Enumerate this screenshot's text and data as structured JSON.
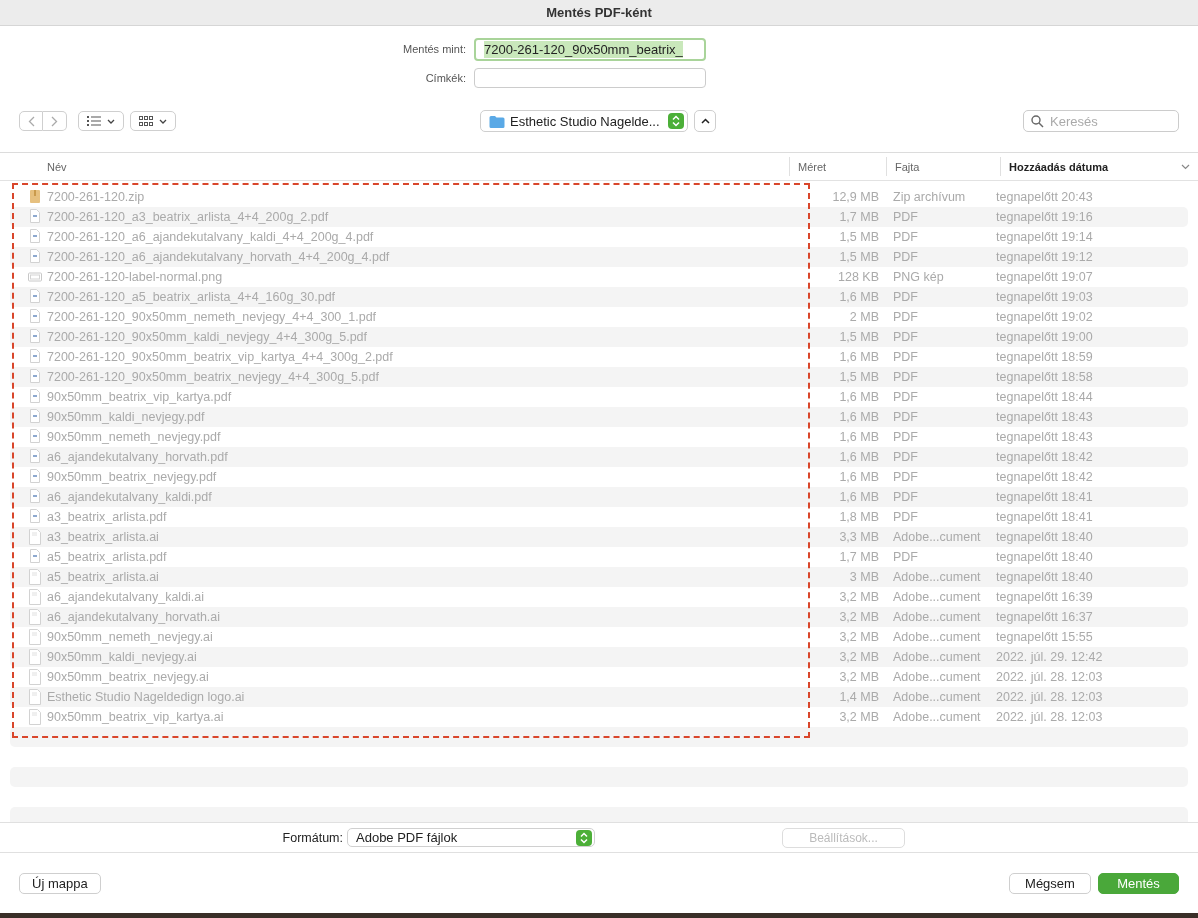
{
  "window": {
    "title": "Mentés PDF-ként"
  },
  "save_as": {
    "label": "Mentés mint:",
    "value": "7200-261-120_90x50mm_beatrix_",
    "selected": true
  },
  "tags": {
    "label": "Címkék:"
  },
  "location": {
    "label": "Esthetic Studio Nagelde..."
  },
  "search": {
    "placeholder": "Keresés"
  },
  "columns": [
    {
      "label": "Név",
      "sorted": false
    },
    {
      "label": "Méret",
      "sorted": false
    },
    {
      "label": "Fajta",
      "sorted": false
    },
    {
      "label": "Hozzáadás dátuma",
      "sorted": true
    }
  ],
  "rows": [
    {
      "kind": "zip",
      "name": "7200-261-120.zip",
      "size": "12,9 MB",
      "kind_label": "Zip archívum",
      "date": "tegnapelőtt 20:43"
    },
    {
      "kind": "pdf",
      "name": "7200-261-120_a3_beatrix_arlista_4+4_200g_2.pdf",
      "size": "1,7 MB",
      "kind_label": "PDF",
      "date": "tegnapelőtt 19:16"
    },
    {
      "kind": "pdf",
      "name": "7200-261-120_a6_ajandekutalvany_kaldi_4+4_200g_4.pdf",
      "size": "1,5 MB",
      "kind_label": "PDF",
      "date": "tegnapelőtt 19:14"
    },
    {
      "kind": "pdf",
      "name": "7200-261-120_a6_ajandekutalvany_horvath_4+4_200g_4.pdf",
      "size": "1,5 MB",
      "kind_label": "PDF",
      "date": "tegnapelőtt 19:12"
    },
    {
      "kind": "png",
      "name": "7200-261-120-label-normal.png",
      "size": "128 KB",
      "kind_label": "PNG kép",
      "date": "tegnapelőtt 19:07"
    },
    {
      "kind": "pdf",
      "name": "7200-261-120_a5_beatrix_arlista_4+4_160g_30.pdf",
      "size": "1,6 MB",
      "kind_label": "PDF",
      "date": "tegnapelőtt 19:03"
    },
    {
      "kind": "pdf",
      "name": "7200-261-120_90x50mm_nemeth_nevjegy_4+4_300_1.pdf",
      "size": "2 MB",
      "kind_label": "PDF",
      "date": "tegnapelőtt 19:02"
    },
    {
      "kind": "pdf",
      "name": "7200-261-120_90x50mm_kaldi_nevjegy_4+4_300g_5.pdf",
      "size": "1,5 MB",
      "kind_label": "PDF",
      "date": "tegnapelőtt 19:00"
    },
    {
      "kind": "pdf",
      "name": "7200-261-120_90x50mm_beatrix_vip_kartya_4+4_300g_2.pdf",
      "size": "1,6 MB",
      "kind_label": "PDF",
      "date": "tegnapelőtt 18:59"
    },
    {
      "kind": "pdf",
      "name": "7200-261-120_90x50mm_beatrix_nevjegy_4+4_300g_5.pdf",
      "size": "1,5 MB",
      "kind_label": "PDF",
      "date": "tegnapelőtt 18:58"
    },
    {
      "kind": "pdf",
      "name": "90x50mm_beatrix_vip_kartya.pdf",
      "size": "1,6 MB",
      "kind_label": "PDF",
      "date": "tegnapelőtt 18:44"
    },
    {
      "kind": "pdf",
      "name": "90x50mm_kaldi_nevjegy.pdf",
      "size": "1,6 MB",
      "kind_label": "PDF",
      "date": "tegnapelőtt 18:43"
    },
    {
      "kind": "pdf",
      "name": "90x50mm_nemeth_nevjegy.pdf",
      "size": "1,6 MB",
      "kind_label": "PDF",
      "date": "tegnapelőtt 18:43"
    },
    {
      "kind": "pdf",
      "name": "a6_ajandekutalvany_horvath.pdf",
      "size": "1,6 MB",
      "kind_label": "PDF",
      "date": "tegnapelőtt 18:42"
    },
    {
      "kind": "pdf",
      "name": "90x50mm_beatrix_nevjegy.pdf",
      "size": "1,6 MB",
      "kind_label": "PDF",
      "date": "tegnapelőtt 18:42"
    },
    {
      "kind": "pdf",
      "name": "a6_ajandekutalvany_kaldi.pdf",
      "size": "1,6 MB",
      "kind_label": "PDF",
      "date": "tegnapelőtt 18:41"
    },
    {
      "kind": "pdf",
      "name": "a3_beatrix_arlista.pdf",
      "size": "1,8 MB",
      "kind_label": "PDF",
      "date": "tegnapelőtt 18:41"
    },
    {
      "kind": "ai",
      "name": "a3_beatrix_arlista.ai",
      "size": "3,3 MB",
      "kind_label": "Adobe...cument",
      "date": "tegnapelőtt 18:40"
    },
    {
      "kind": "pdf",
      "name": "a5_beatrix_arlista.pdf",
      "size": "1,7 MB",
      "kind_label": "PDF",
      "date": "tegnapelőtt 18:40"
    },
    {
      "kind": "ai",
      "name": "a5_beatrix_arlista.ai",
      "size": "3 MB",
      "kind_label": "Adobe...cument",
      "date": "tegnapelőtt 18:40"
    },
    {
      "kind": "ai",
      "name": "a6_ajandekutalvany_kaldi.ai",
      "size": "3,2 MB",
      "kind_label": "Adobe...cument",
      "date": "tegnapelőtt 16:39"
    },
    {
      "kind": "ai",
      "name": "a6_ajandekutalvany_horvath.ai",
      "size": "3,2 MB",
      "kind_label": "Adobe...cument",
      "date": "tegnapelőtt 16:37"
    },
    {
      "kind": "ai",
      "name": "90x50mm_nemeth_nevjegy.ai",
      "size": "3,2 MB",
      "kind_label": "Adobe...cument",
      "date": "tegnapelőtt 15:55"
    },
    {
      "kind": "ai",
      "name": "90x50mm_kaldi_nevjegy.ai",
      "size": "3,2 MB",
      "kind_label": "Adobe...cument",
      "date": "2022. júl. 29. 12:42"
    },
    {
      "kind": "ai",
      "name": "90x50mm_beatrix_nevjegy.ai",
      "size": "3,2 MB",
      "kind_label": "Adobe...cument",
      "date": "2022. júl. 28. 12:03"
    },
    {
      "kind": "ai",
      "name": "Esthetic Studio Nageldedign logo.ai",
      "size": "1,4 MB",
      "kind_label": "Adobe...cument",
      "date": "2022. júl. 28. 12:03"
    },
    {
      "kind": "ai",
      "name": "90x50mm_beatrix_vip_kartya.ai",
      "size": "3,2 MB",
      "kind_label": "Adobe...cument",
      "date": "2022. júl. 28. 12:03"
    }
  ],
  "format": {
    "label": "Formátum:",
    "value": "Adobe PDF fájlok"
  },
  "options_button": {
    "label": "Beállítások...",
    "disabled": true
  },
  "buttons": [
    {
      "label": "Új mappa",
      "primary": false
    },
    {
      "label": "Mégsem",
      "primary": false
    },
    {
      "label": "Mentés",
      "primary": true
    }
  ]
}
